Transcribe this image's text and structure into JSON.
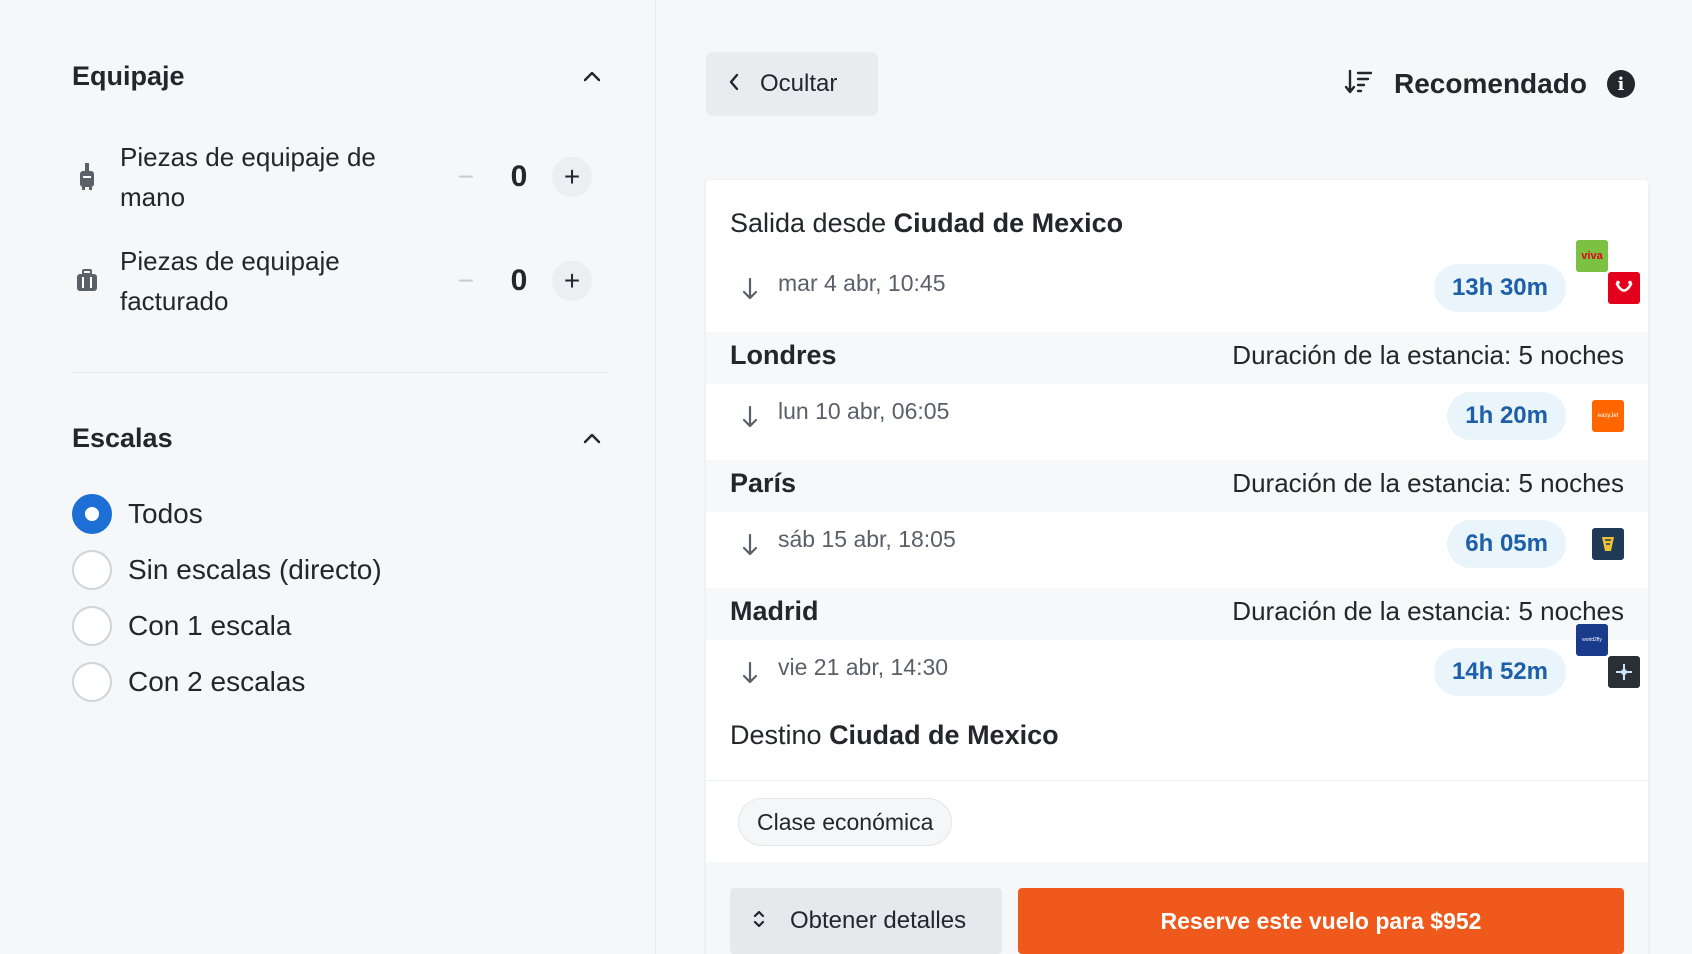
{
  "filters": {
    "baggage": {
      "title": "Equipaje",
      "items": [
        {
          "label": "Piezas de equipaje de mano",
          "minus": "−",
          "value": "0",
          "plus": "+"
        },
        {
          "label": "Piezas de equipaje facturado",
          "minus": "−",
          "value": "0",
          "plus": "+"
        }
      ]
    },
    "stops": {
      "title": "Escalas",
      "options": [
        {
          "label": "Todos",
          "selected": true
        },
        {
          "label": "Sin escalas (directo)",
          "selected": false
        },
        {
          "label": "Con 1 escala",
          "selected": false
        },
        {
          "label": "Con 2 escalas",
          "selected": false
        }
      ]
    }
  },
  "toolbar": {
    "hide_label": "Ocultar",
    "sort_label": "Recomendado",
    "info_glyph": "i"
  },
  "result": {
    "depart_prefix": "Salida desde",
    "depart_city": "Ciudad de Mexico",
    "legs": [
      {
        "date": "mar 4 abr, 10:45",
        "duration": "13h 30m",
        "airline_logos": [
          "viva-logo",
          "tui-logo"
        ]
      },
      {
        "date": "lun 10 abr, 06:05",
        "duration": "1h 20m",
        "airline_logos": [
          "easyjet-logo"
        ]
      },
      {
        "date": "sáb 15 abr, 18:05",
        "duration": "6h 05m",
        "airline_logos": [
          "aer-lingus-logo"
        ]
      },
      {
        "date": "vie 21 abr, 14:30",
        "duration": "14h 52m",
        "airline_logos": [
          "world2fly-logo",
          "airline-star-logo"
        ]
      }
    ],
    "stops": [
      {
        "city": "Londres",
        "stay": "Duración de la estancia: 5 noches"
      },
      {
        "city": "París",
        "stay": "Duración de la estancia: 5 noches"
      },
      {
        "city": "Madrid",
        "stay": "Duración de la estancia: 5 noches"
      }
    ],
    "dest_prefix": "Destino",
    "dest_city": "Ciudad de Mexico",
    "cabin_class": "Clase económica",
    "details_label": "Obtener detalles",
    "book_label": "Reserve este vuelo para $952"
  },
  "colors": {
    "accent_blue": "#1d6fd6",
    "duration_bg": "#eaf4fb",
    "duration_text": "#1d5fa8",
    "book_orange": "#ef5a1c",
    "viva_green": "#7cc242",
    "tui_red": "#e2001a",
    "easyjet_orange": "#ff6600",
    "aer_lingus_navy": "#1f3b57",
    "world2fly_blue": "#1a3a8c"
  },
  "icons": {
    "collapse": "chevron-up-icon",
    "hand_bag": "carry-on-bag-icon",
    "checked_bag": "suitcase-icon",
    "hide": "chevron-left-icon",
    "sort": "sort-icon",
    "info": "info-icon",
    "leg_arrow": "arrow-down-icon",
    "expand": "expand-icon"
  }
}
